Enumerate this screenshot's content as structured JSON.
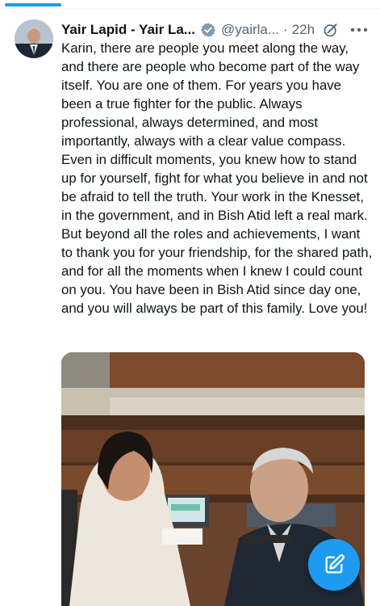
{
  "tweet": {
    "author_name": "Yair Lapid - Yair La...",
    "handle": "@yairla...",
    "separator": "·",
    "time": "22h",
    "text": "Karin, there are people you meet along the way, and there are people who become part of the way itself. You are one of them. For years you have been a true fighter for the public. Always professional, always determined, and most importantly, always with a clear value compass. Even in difficult moments, you knew how to stand up for yourself, fight for what you believe in and not be afraid to tell the truth. Your work in the Knesset, in the government, and in Bish Atid left a real mark. But beyond all the roles and achievements, I want to thank you for your friendship, for the shared path, and for all the moments when I knew I could count on you. You have been in Bish Atid since day one, and you will always be part of this family. Love you!"
  },
  "icons": {
    "verified": "verified-badge-icon",
    "edit": "edited-icon",
    "more": "more-options-icon",
    "compose": "compose-icon"
  },
  "colors": {
    "accent": "#1d9bf0",
    "text": "#0f1419",
    "secondary": "#536471"
  }
}
